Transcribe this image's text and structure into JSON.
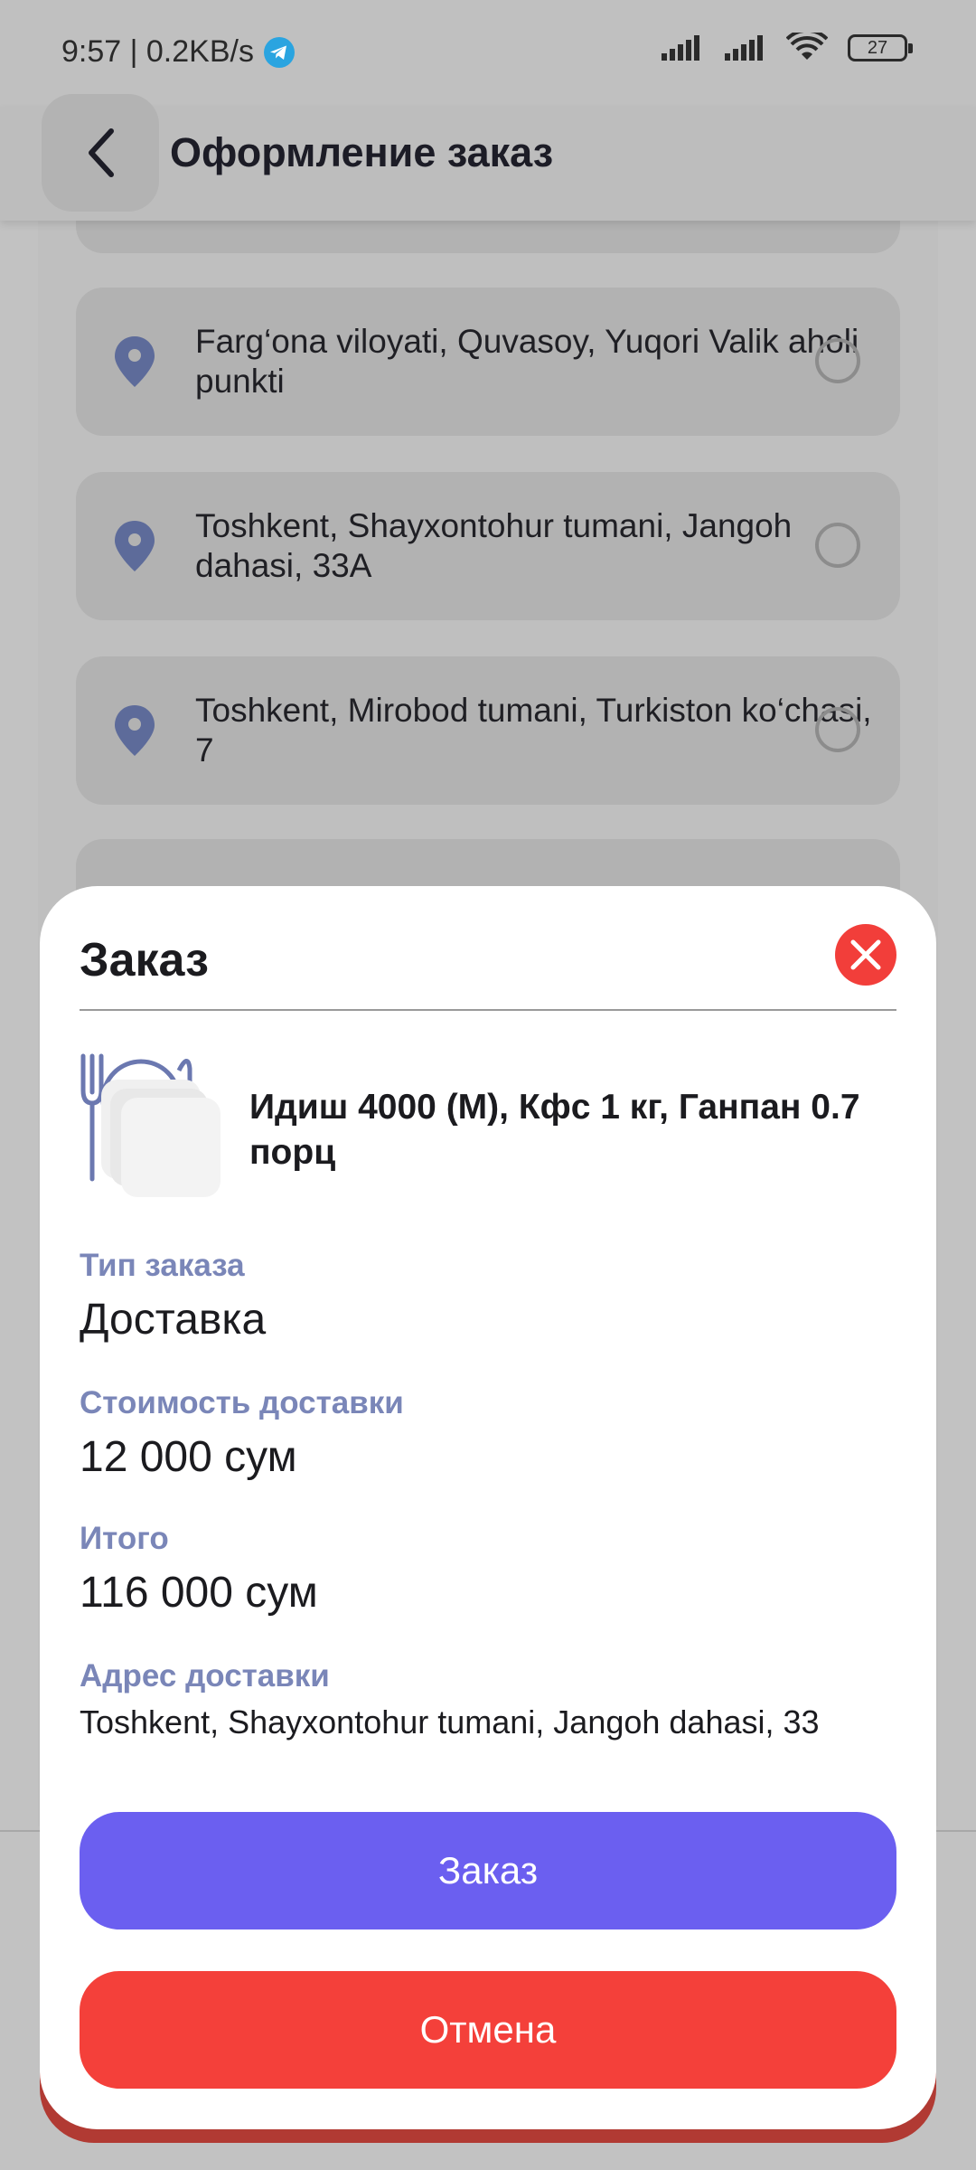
{
  "status_bar": {
    "time_speed": "9:57 | 0.2KB/s",
    "battery": "27"
  },
  "header": {
    "title": "Оформление заказ"
  },
  "addresses": [
    {
      "text": "Farg‘ona viloyati, Quvasoy, Yuqori Valik aholi punkti",
      "selected": false
    },
    {
      "text": "Toshkent, Shayxontohur tumani, Jangoh dahasi, 33A",
      "selected": false
    },
    {
      "text": "Toshkent, Mirobod tumani, Turkiston ko‘chasi, 7",
      "selected": false
    }
  ],
  "sheet": {
    "title": "Заказ",
    "product_name": "Идиш 4000 (M), Кфс 1 кг, Ганпан 0.7 порц",
    "order_type_label": "Тип заказа",
    "order_type_value": "Доставка",
    "delivery_cost_label": "Стоимость доставки",
    "delivery_cost_value": "12 000 сум",
    "total_label": "Итого",
    "total_value": "116 000 сум",
    "address_label": "Адрес доставки",
    "address_value": "Toshkent, Shayxontohur tumani, Jangoh dahasi, 33",
    "order_button": "Заказ",
    "cancel_button": "Отмена"
  },
  "colors": {
    "accent_primary": "#6b5ff0",
    "accent_danger": "#f4403a",
    "label_muted": "#7a86b8",
    "pin_icon": "#5d6b9a"
  }
}
